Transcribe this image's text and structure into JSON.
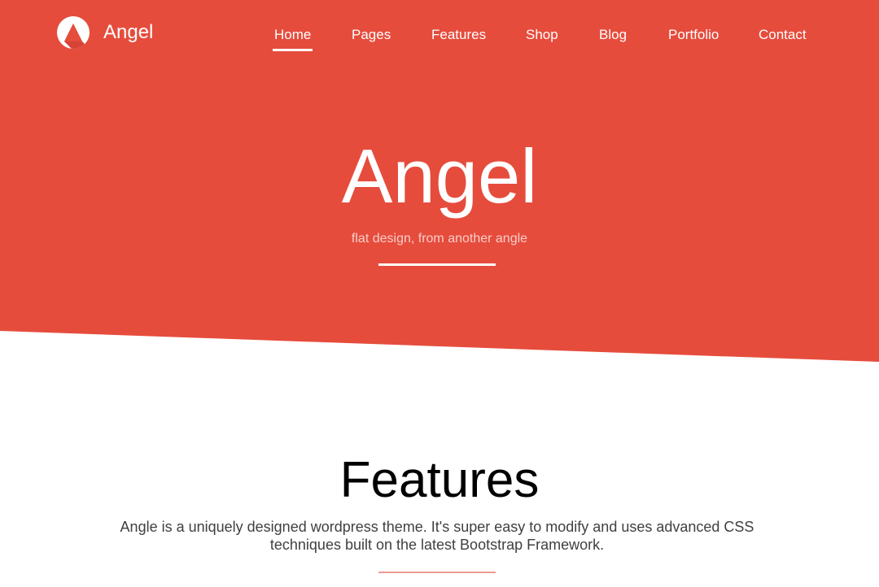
{
  "colors": {
    "brand_red": "#e64c3c",
    "white": "#ffffff"
  },
  "brand": {
    "name": "Angel",
    "logo_icon": "angle-logo-icon"
  },
  "nav": {
    "items": [
      {
        "label": "Home",
        "active": true
      },
      {
        "label": "Pages",
        "active": false
      },
      {
        "label": "Features",
        "active": false
      },
      {
        "label": "Shop",
        "active": false
      },
      {
        "label": "Blog",
        "active": false
      },
      {
        "label": "Portfolio",
        "active": false
      },
      {
        "label": "Contact",
        "active": false
      }
    ]
  },
  "hero": {
    "title": "Angel",
    "subtitle": "flat design, from another angle"
  },
  "features": {
    "title": "Features",
    "description": "Angle is a uniquely designed wordpress theme. It's super easy to modify and uses advanced CSS techniques built on the latest Bootstrap Framework."
  }
}
